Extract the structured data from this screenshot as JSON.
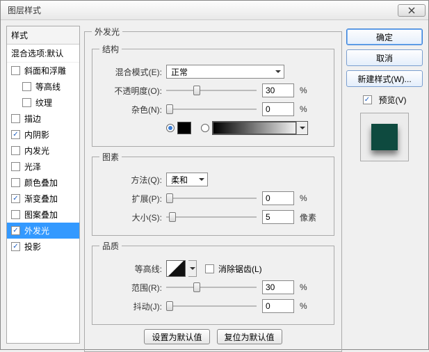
{
  "title": "图层样式",
  "left": {
    "header": "样式",
    "subheader": "混合选项:默认",
    "items": [
      {
        "label": "斜面和浮雕",
        "checked": false,
        "indent": false
      },
      {
        "label": "等高线",
        "checked": false,
        "indent": true
      },
      {
        "label": "纹理",
        "checked": false,
        "indent": true
      },
      {
        "label": "描边",
        "checked": false,
        "indent": false
      },
      {
        "label": "内阴影",
        "checked": true,
        "indent": false
      },
      {
        "label": "内发光",
        "checked": false,
        "indent": false
      },
      {
        "label": "光泽",
        "checked": false,
        "indent": false
      },
      {
        "label": "颜色叠加",
        "checked": false,
        "indent": false
      },
      {
        "label": "渐变叠加",
        "checked": true,
        "indent": false
      },
      {
        "label": "图案叠加",
        "checked": false,
        "indent": false
      },
      {
        "label": "外发光",
        "checked": true,
        "indent": false,
        "selected": true
      },
      {
        "label": "投影",
        "checked": true,
        "indent": false
      }
    ]
  },
  "center": {
    "title": "外发光",
    "section_structure": "结构",
    "blend_label": "混合模式(E):",
    "blend_value": "正常",
    "opacity_label": "不透明度(O):",
    "opacity_value": "30",
    "opacity_unit": "%",
    "noise_label": "杂色(N):",
    "noise_value": "0",
    "noise_unit": "%",
    "section_elements": "图素",
    "method_label": "方法(Q):",
    "method_value": "柔和",
    "spread_label": "扩展(P):",
    "spread_value": "0",
    "spread_unit": "%",
    "size_label": "大小(S):",
    "size_value": "5",
    "size_unit": "像素",
    "section_quality": "品质",
    "contour_label": "等高线:",
    "antialias_label": "消除锯齿(L)",
    "range_label": "范围(R):",
    "range_value": "30",
    "range_unit": "%",
    "jitter_label": "抖动(J):",
    "jitter_value": "0",
    "jitter_unit": "%",
    "btn_default": "设置为默认值",
    "btn_reset": "复位为默认值"
  },
  "right": {
    "ok": "确定",
    "cancel": "取消",
    "newstyle": "新建样式(W)...",
    "preview": "预览(V)"
  }
}
